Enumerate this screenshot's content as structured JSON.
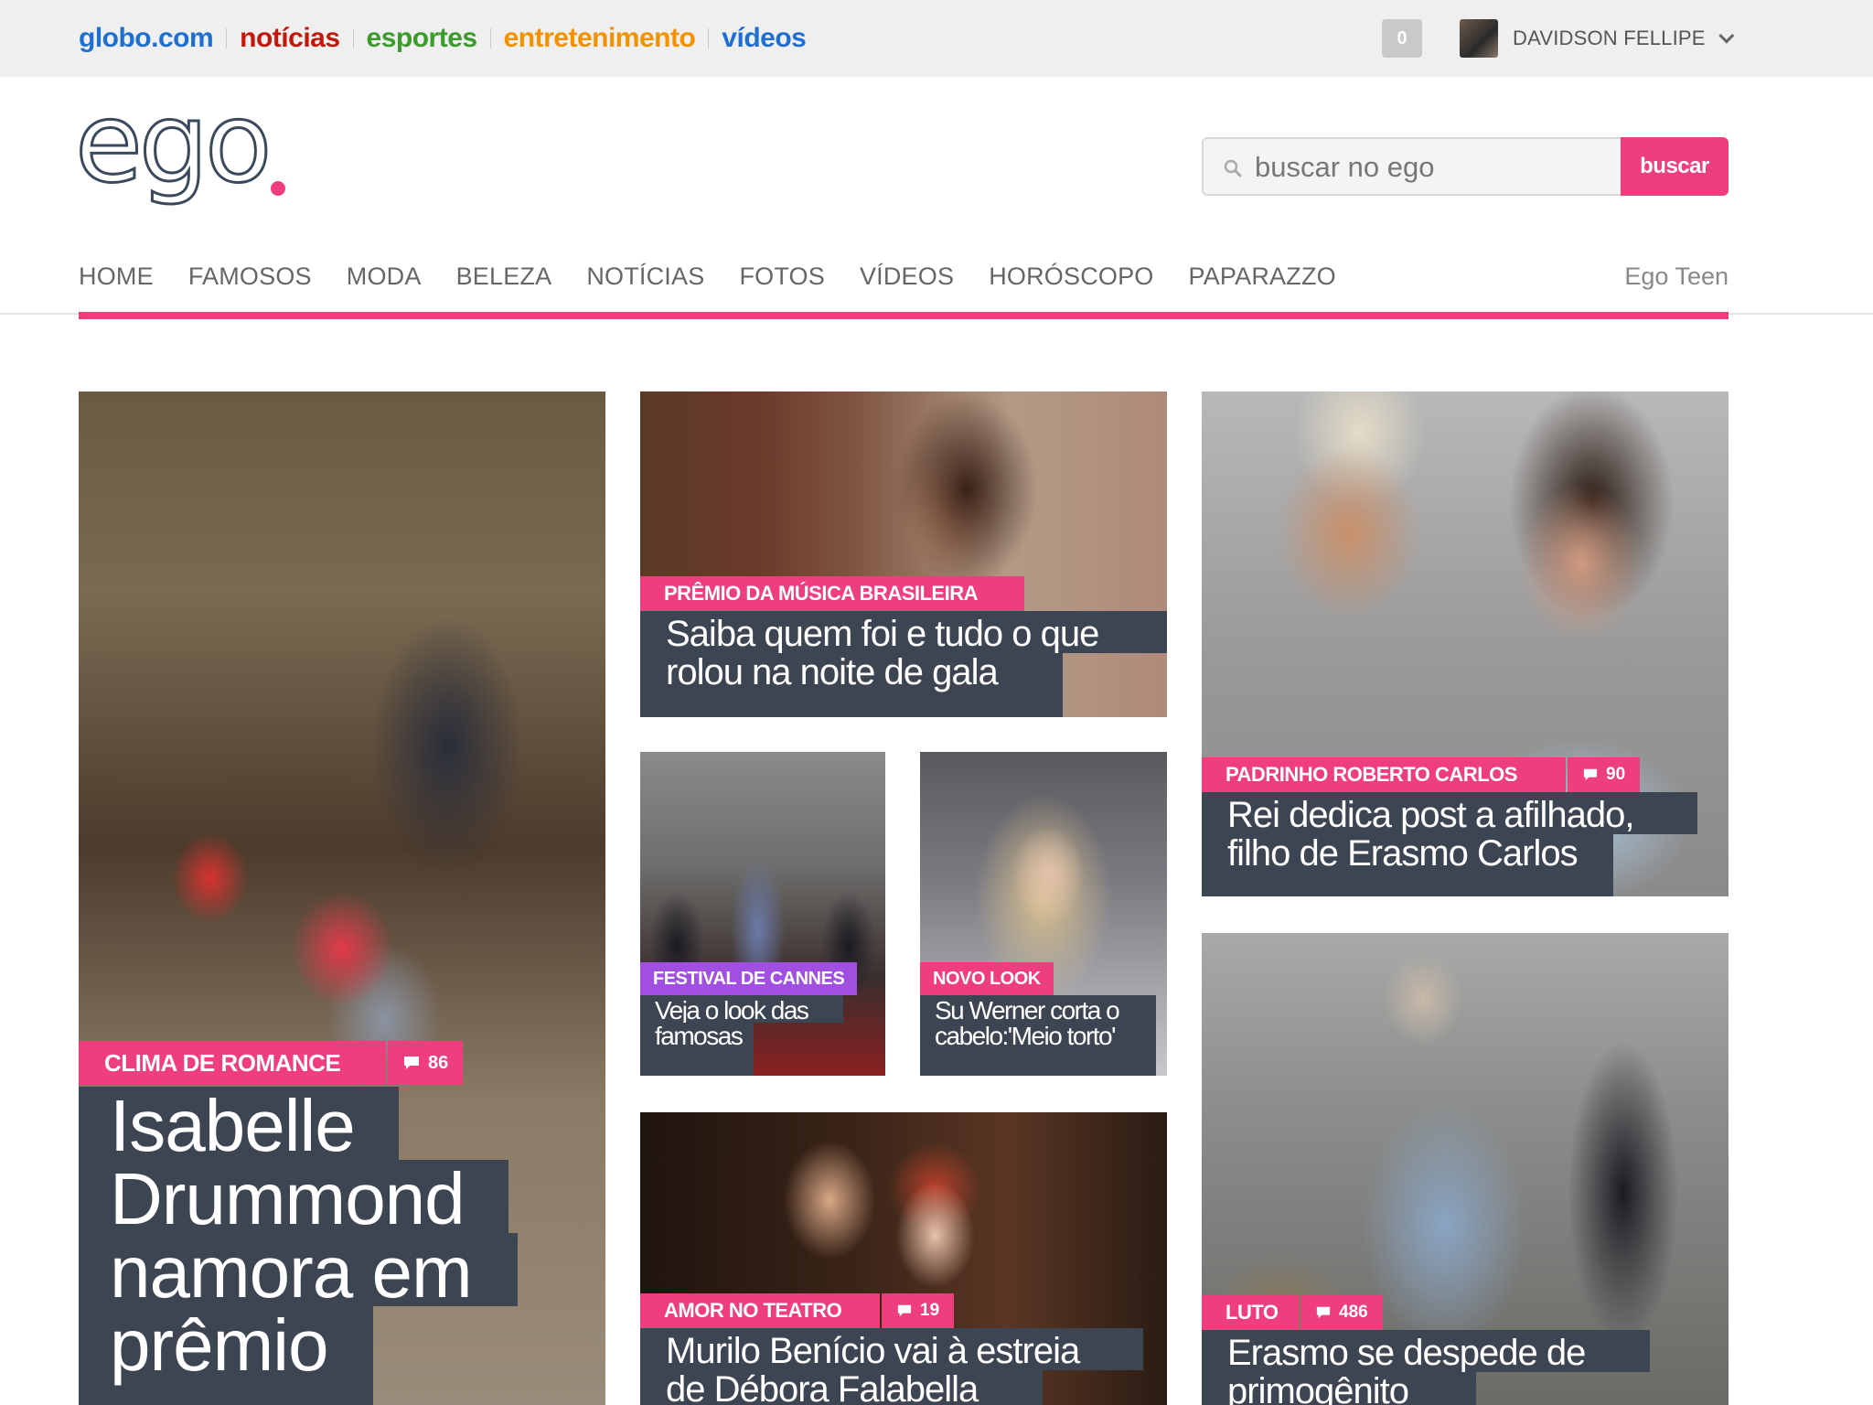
{
  "globalbar": {
    "links": [
      {
        "label": "globo.com",
        "color": "#1f6fd0"
      },
      {
        "label": "notícias",
        "color": "#c4170c"
      },
      {
        "label": "esportes",
        "color": "#3b9b2b"
      },
      {
        "label": "entretenimento",
        "color": "#f39200"
      },
      {
        "label": "vídeos",
        "color": "#1f6fd0"
      }
    ],
    "counter": "0",
    "username": "DAVIDSON FELLIPE"
  },
  "header": {
    "logo_text": "ego",
    "search_placeholder": "buscar no ego",
    "search_button": "buscar",
    "accent_color": "#ef3e7e"
  },
  "nav": {
    "items": [
      "HOME",
      "FAMOSOS",
      "MODA",
      "BELEZA",
      "NOTÍCIAS",
      "FOTOS",
      "VÍDEOS",
      "HORÓSCOPO",
      "PAPARAZZO"
    ],
    "right": "Ego Teen"
  },
  "cards": {
    "main": {
      "tag": "CLIMA DE ROMANCE",
      "comments": "86",
      "headline_lines": [
        "Isabelle",
        "Drummond",
        "namora em",
        "prêmio"
      ]
    },
    "premio": {
      "tag": "PRÊMIO DA MÚSICA BRASILEIRA",
      "headline_lines": [
        "Saiba quem foi e tudo o que",
        "rolou na noite de gala"
      ]
    },
    "cannes": {
      "tag": "FESTIVAL DE CANNES",
      "headline_lines": [
        "Veja o look das",
        "famosas"
      ]
    },
    "novolook": {
      "tag": "NOVO LOOK",
      "headline_lines": [
        "Su Werner corta o",
        "cabelo:'Meio torto'"
      ]
    },
    "teatro": {
      "tag": "AMOR NO TEATRO",
      "comments": "19",
      "headline_lines": [
        "Murilo Benício vai à estreia",
        "de Débora Falabella"
      ]
    },
    "padrinho": {
      "tag": "PADRINHO ROBERTO CARLOS",
      "comments": "90",
      "headline_lines": [
        "Rei dedica post a afilhado,",
        "filho de Erasmo Carlos"
      ]
    },
    "luto": {
      "tag": "LUTO",
      "comments": "486",
      "headline_lines": [
        "Erasmo se despede de",
        "primogênito"
      ]
    }
  }
}
